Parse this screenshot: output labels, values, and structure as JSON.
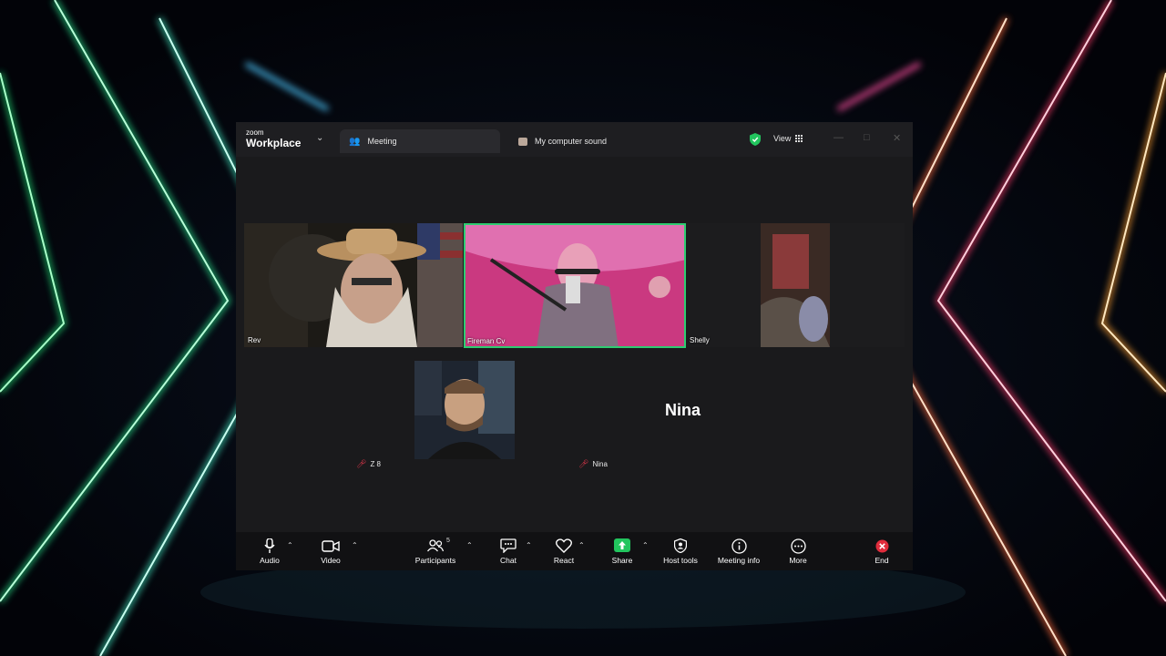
{
  "app": {
    "brand_top": "zoom",
    "brand_bottom": "Workplace",
    "tabs": [
      {
        "label": "Meeting",
        "active": true
      },
      {
        "label": "My computer sound",
        "active": false
      }
    ],
    "view_label": "View",
    "security_color": "#22c55e"
  },
  "participants": [
    {
      "name": "Rev",
      "video": true
    },
    {
      "name": "Fireman Cv",
      "video": true,
      "speaking": true
    },
    {
      "name": "Shelly",
      "video": true
    },
    {
      "name": "Z 8",
      "video": true,
      "muted": true
    },
    {
      "name": "Nina",
      "video": false,
      "muted": true,
      "card_name": "Nina"
    }
  ],
  "toolbar": {
    "audio": "Audio",
    "video": "Video",
    "participants": "Participants",
    "participants_count": "5",
    "chat": "Chat",
    "react": "React",
    "share": "Share",
    "host_tools": "Host tools",
    "meeting_info": "Meeting info",
    "more": "More",
    "end": "End",
    "share_color": "#22c55e",
    "end_color": "#e02c3c"
  },
  "colors": {
    "active_speaker": "#2ecc71",
    "muted": "#e0364a"
  }
}
